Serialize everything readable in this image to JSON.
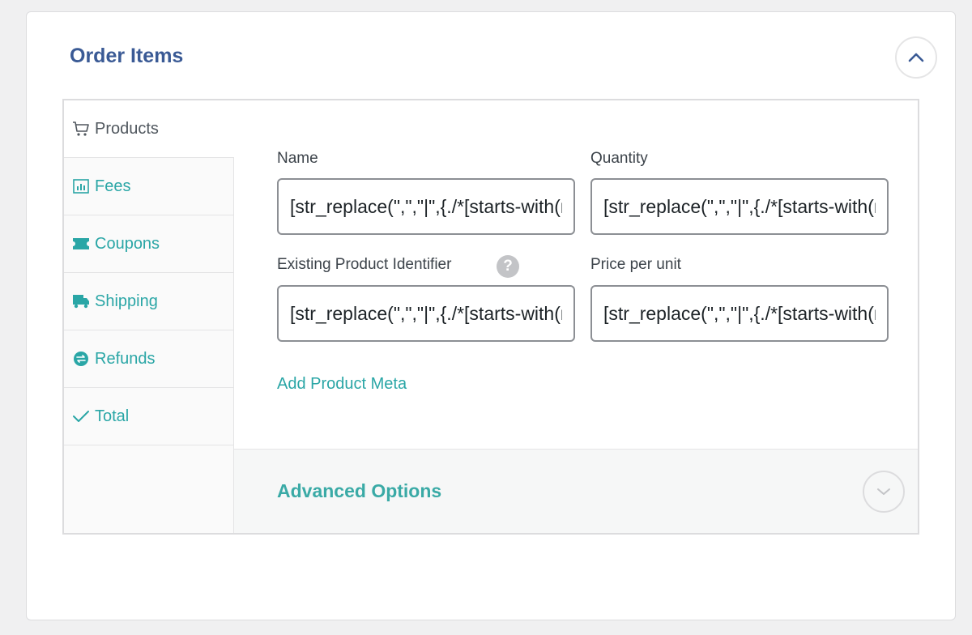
{
  "panel": {
    "title": "Order Items",
    "collapse_icon": "chevron-up-icon"
  },
  "tabs": [
    {
      "label": "Products",
      "icon": "cart-icon",
      "active": true
    },
    {
      "label": "Fees",
      "icon": "chart-icon",
      "active": false
    },
    {
      "label": "Coupons",
      "icon": "ticket-icon",
      "active": false
    },
    {
      "label": "Shipping",
      "icon": "truck-icon",
      "active": false
    },
    {
      "label": "Refunds",
      "icon": "refund-icon",
      "active": false
    },
    {
      "label": "Total",
      "icon": "checkmark-icon",
      "active": false
    }
  ],
  "fields": {
    "name": {
      "label": "Name",
      "value": "[str_replace(\",\",\"|\",{./*[starts-with(name(),'line_item_')]/name})]"
    },
    "quantity": {
      "label": "Quantity",
      "value": "[str_replace(\",\",\"|\",{./*[starts-with(name(),'line_item_')]/quantity})]"
    },
    "product_id": {
      "label": "Existing Product Identifier",
      "help": "?",
      "value": "[str_replace(\",\",\"|\",{./*[starts-with(name(),'line_item_')]/sku})]"
    },
    "price": {
      "label": "Price per unit",
      "value": "[str_replace(\",\",\"|\",{./*[starts-with(name(),'line_item_')]/price})]"
    }
  },
  "add_meta_label": "Add Product Meta",
  "advanced": {
    "title": "Advanced Options",
    "expand_icon": "chevron-down-icon"
  },
  "colors": {
    "title": "#3a5a95",
    "accent": "#2aa6a6",
    "background": "#f0f0f1"
  }
}
